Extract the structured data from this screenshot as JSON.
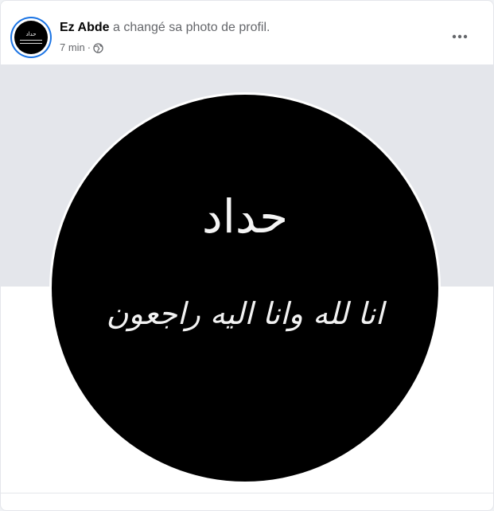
{
  "post": {
    "author": "Ez Abde",
    "action": "a changé sa photo de profil.",
    "timestamp": "7 min",
    "separator": "·",
    "privacy_icon": "globe-icon",
    "more_icon": "more-options-icon"
  },
  "avatar": {
    "line1": "حداد"
  },
  "profile_photo": {
    "title": "حداد",
    "verse": "انا لله وانا اليه راجعون"
  },
  "colors": {
    "card_bg": "#ffffff",
    "cover_bg": "#e4e6eb",
    "photo_bg": "#000000",
    "story_ring": "#1b74e4",
    "author_text": "#050505",
    "secondary_text": "#65676b"
  }
}
